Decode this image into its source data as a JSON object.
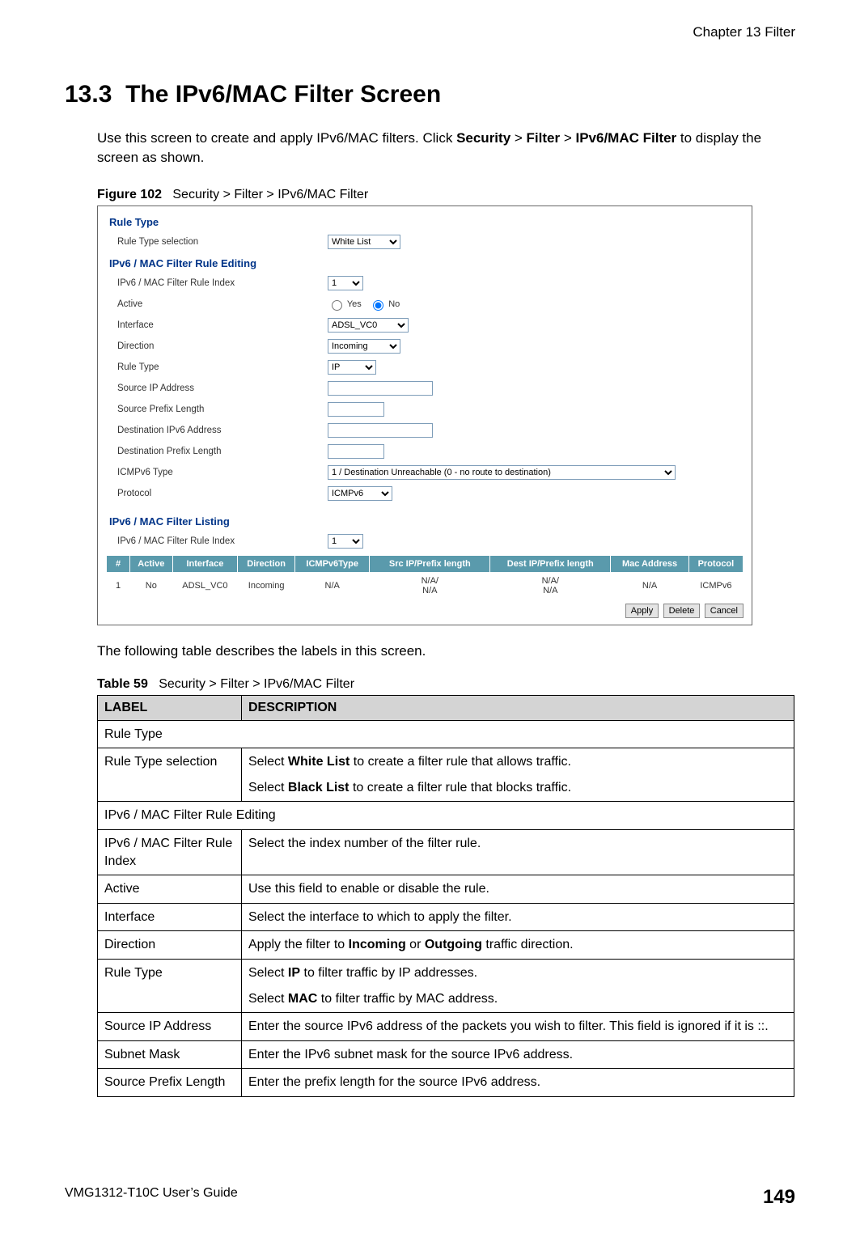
{
  "header": {
    "chapter": "Chapter 13 Filter"
  },
  "section": {
    "number": "13.3",
    "title": "The IPv6/MAC Filter Screen",
    "intro_a": "Use this screen to create and apply IPv6/MAC filters. Click ",
    "nav1": "Security",
    "sep": " > ",
    "nav2": "Filter",
    "nav3": "IPv6/MAC Filter",
    "intro_b": " to display the screen as shown."
  },
  "figure": {
    "label": "Figure 102",
    "caption": "Security > Filter > IPv6/MAC Filter",
    "rule_type_hdr": "Rule Type",
    "rule_type_sel_lbl": "Rule Type selection",
    "rule_type_sel_val": "White List",
    "edit_hdr": "IPv6 / MAC Filter Rule Editing",
    "idx_lbl": "IPv6 / MAC Filter Rule Index",
    "idx_val": "1",
    "active_lbl": "Active",
    "active_yes": "Yes",
    "active_no": "No",
    "iface_lbl": "Interface",
    "iface_val": "ADSL_VC0",
    "dir_lbl": "Direction",
    "dir_val": "Incoming",
    "ruletype2_lbl": "Rule Type",
    "ruletype2_val": "IP",
    "srcip_lbl": "Source IP Address",
    "srcplen_lbl": "Source Prefix Length",
    "dstip_lbl": "Destination IPv6 Address",
    "dstplen_lbl": "Destination Prefix Length",
    "icmp_lbl": "ICMPv6 Type",
    "icmp_val": "1 / Destination Unreachable (0 - no route to destination)",
    "proto_lbl": "Protocol",
    "proto_val": "ICMPv6",
    "listing_hdr": "IPv6 / MAC Filter Listing",
    "listing_idx_lbl": "IPv6 / MAC Filter Rule Index",
    "listing_idx_val": "1",
    "th": {
      "num": "#",
      "active": "Active",
      "iface": "Interface",
      "dir": "Direction",
      "icmp": "ICMPv6Type",
      "src": "Src IP/Prefix length",
      "dst": "Dest IP/Prefix length",
      "mac": "Mac Address",
      "proto": "Protocol"
    },
    "row": {
      "num": "1",
      "active": "No",
      "iface": "ADSL_VC0",
      "dir": "Incoming",
      "icmp": "N/A",
      "src": "N/A/\nN/A",
      "dst": "N/A/\nN/A",
      "mac": "N/A",
      "proto": "ICMPv6"
    },
    "btn_apply": "Apply",
    "btn_delete": "Delete",
    "btn_cancel": "Cancel"
  },
  "post_text": "The following table describes the labels in this screen.",
  "table": {
    "label": "Table 59",
    "caption": "Security > Filter > IPv6/MAC Filter",
    "h1": "LABEL",
    "h2": "DESCRIPTION",
    "rows": [
      {
        "span": true,
        "label": "Rule Type"
      },
      {
        "label": "Rule Type selection",
        "desc_a": "Select ",
        "b1": "White List",
        "desc_b": " to create a filter rule that allows traffic.",
        "desc_c": "Select ",
        "b2": "Black List",
        "desc_d": " to create a filter rule that blocks traffic."
      },
      {
        "span": true,
        "label": "IPv6 / MAC Filter Rule Editing"
      },
      {
        "label": "IPv6 / MAC Filter Rule Index",
        "desc": "Select the index number of the filter rule."
      },
      {
        "label": "Active",
        "desc": "Use this field to enable or disable the rule."
      },
      {
        "label": "Interface",
        "desc": "Select the interface to which to apply the filter."
      },
      {
        "label": "Direction",
        "desc_a": "Apply the filter to ",
        "b1": "Incoming",
        "mid": " or ",
        "b2": "Outgoing",
        "desc_b": " traffic direction."
      },
      {
        "label": "Rule Type",
        "desc_a": "Select ",
        "b1": "IP",
        "desc_b": " to filter traffic by IP addresses.",
        "desc_c": "Select ",
        "b2": "MAC",
        "desc_d": " to filter traffic by MAC address."
      },
      {
        "label": "Source IP Address",
        "desc": "Enter the source IPv6 address of the packets you wish to filter. This field is ignored if it is ::."
      },
      {
        "label": "Subnet Mask",
        "desc": "Enter the IPv6 subnet mask for the source IPv6 address."
      },
      {
        "label": "Source Prefix Length",
        "desc": "Enter the prefix length for the source IPv6 address."
      }
    ]
  },
  "footer": {
    "guide": "VMG1312-T10C User’s Guide",
    "page": "149"
  }
}
